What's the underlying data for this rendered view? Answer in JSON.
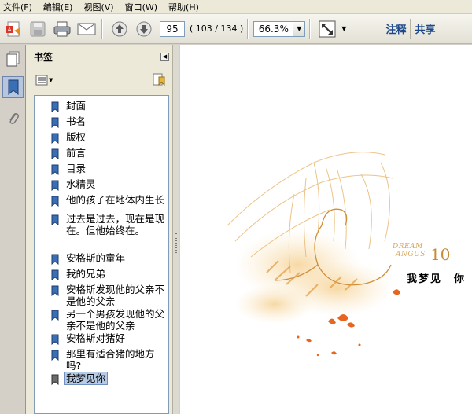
{
  "menu": [
    "文件(F)",
    "编辑(E)",
    "视图(V)",
    "窗口(W)",
    "帮助(H)"
  ],
  "toolbar": {
    "page_value": "95",
    "page_count": "( 103 / 134 )",
    "zoom_value": "66.3%",
    "annotate_label": "注释",
    "share_label": "共享"
  },
  "panel": {
    "title": "书签"
  },
  "bookmarks": [
    {
      "label": "封面"
    },
    {
      "label": "书名"
    },
    {
      "label": "版权"
    },
    {
      "label": "前言"
    },
    {
      "label": "目录"
    },
    {
      "label": "水精灵"
    },
    {
      "label": "他的孩子在地体内生长"
    },
    {
      "label": "过去是过去，现在是现在。但他始终在。"
    },
    {
      "label": "安格斯的童年"
    },
    {
      "label": "我的兄弟"
    },
    {
      "label": "安格斯发现他的父亲不是他的父亲"
    },
    {
      "label": "另一个男孩发现他的父亲不是他的父亲"
    },
    {
      "label": "安格斯对猪好"
    },
    {
      "label": "那里有适合猪的地方吗?"
    },
    {
      "label": "我梦见你"
    }
  ],
  "page": {
    "chapter_en_line1": "DREAM",
    "chapter_en_line2": "ANGUS",
    "chapter_number": "10",
    "chapter_title": "我梦见　你"
  },
  "colors": {
    "accent": "#1e4a8c",
    "selection": "#b7cbe6",
    "illustration": "#e8a24a"
  }
}
